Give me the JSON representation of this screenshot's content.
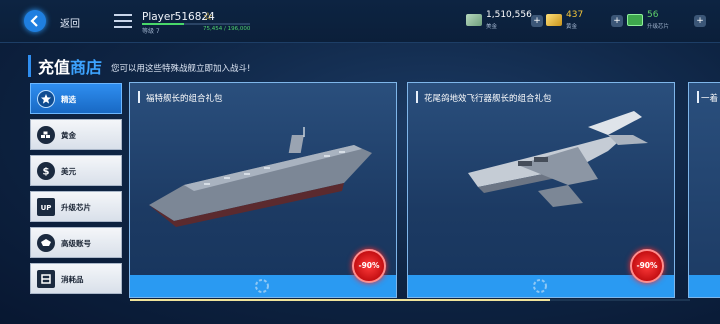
{
  "topbar": {
    "back_label": "返回",
    "player_name": "Player516824",
    "level_label": "等级 7",
    "xp_text": "75,454 / 196,000",
    "xp_fraction": 0.385
  },
  "currencies": [
    {
      "value": "1,510,556",
      "label": "美金",
      "color": "#9fc7a8",
      "icon": "cash-icon"
    },
    {
      "value": "437",
      "label": "黄金",
      "color": "#f2c53a",
      "icon": "gold-icon"
    },
    {
      "value": "56",
      "label": "升级芯片",
      "color": "#5fd06a",
      "icon": "chip-icon"
    }
  ],
  "header": {
    "title_part1": "充值",
    "title_part2": "商店",
    "subtitle": "您可以用这些特殊战舰立即加入战斗!"
  },
  "sidebar": {
    "items": [
      {
        "label": "精选",
        "icon": "featured-icon",
        "active": true
      },
      {
        "label": "黄金",
        "icon": "gold-bars-icon",
        "active": false
      },
      {
        "label": "美元",
        "icon": "dollar-icon",
        "active": false
      },
      {
        "label": "升级芯片",
        "icon": "upgrade-icon",
        "active": false
      },
      {
        "label": "高级账号",
        "icon": "premium-icon",
        "active": false
      },
      {
        "label": "消耗品",
        "icon": "consumables-icon",
        "active": false
      }
    ]
  },
  "cards": [
    {
      "title": "福特舰长的组合礼包",
      "discount": "-90%"
    },
    {
      "title": "花尾鸽地效飞行器舰长的组合礼包",
      "discount": "-90%"
    },
    {
      "title": "一着"
    }
  ],
  "colors": {
    "accent": "#2f8ef0",
    "discount_red": "#e01a1e",
    "xp_green": "#4fd06c"
  },
  "scroll_progress": 0.75
}
